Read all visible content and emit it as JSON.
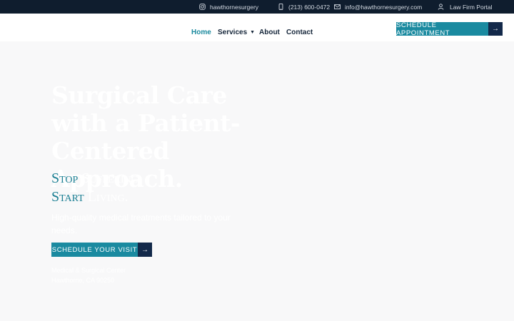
{
  "topbar": {
    "instagram": "hawthornesurgery",
    "phone": "(213) 600-0472",
    "email": "info@hawthornesurgery.com",
    "portal": "Law Firm Portal"
  },
  "nav": {
    "home": "Home",
    "services": "Services",
    "about": "About",
    "contact": "Contact"
  },
  "header": {
    "cta_label": "Schedule Appointment",
    "cta_arrow": "→"
  },
  "hero": {
    "title": "Surgical Care with a Patient-Centered Approach.",
    "tagline_1_a": "Stop",
    "tagline_1_b": "Suffering.",
    "tagline_2_a": "Start",
    "tagline_2_b": "Living.",
    "subtext": "High-quality medical treatments tailored to your needs.",
    "cta_label": "Schedule Your Visit",
    "cta_arrow": "→",
    "address_line1": "Medical & Surgical Center",
    "address_line2": "Hawthorne, CA 90250"
  },
  "colors": {
    "topbar_bg": "#0f1d2e",
    "accent_teal": "#1a8aa0",
    "navy": "#13294a",
    "page_bg": "#f8f8f9"
  }
}
